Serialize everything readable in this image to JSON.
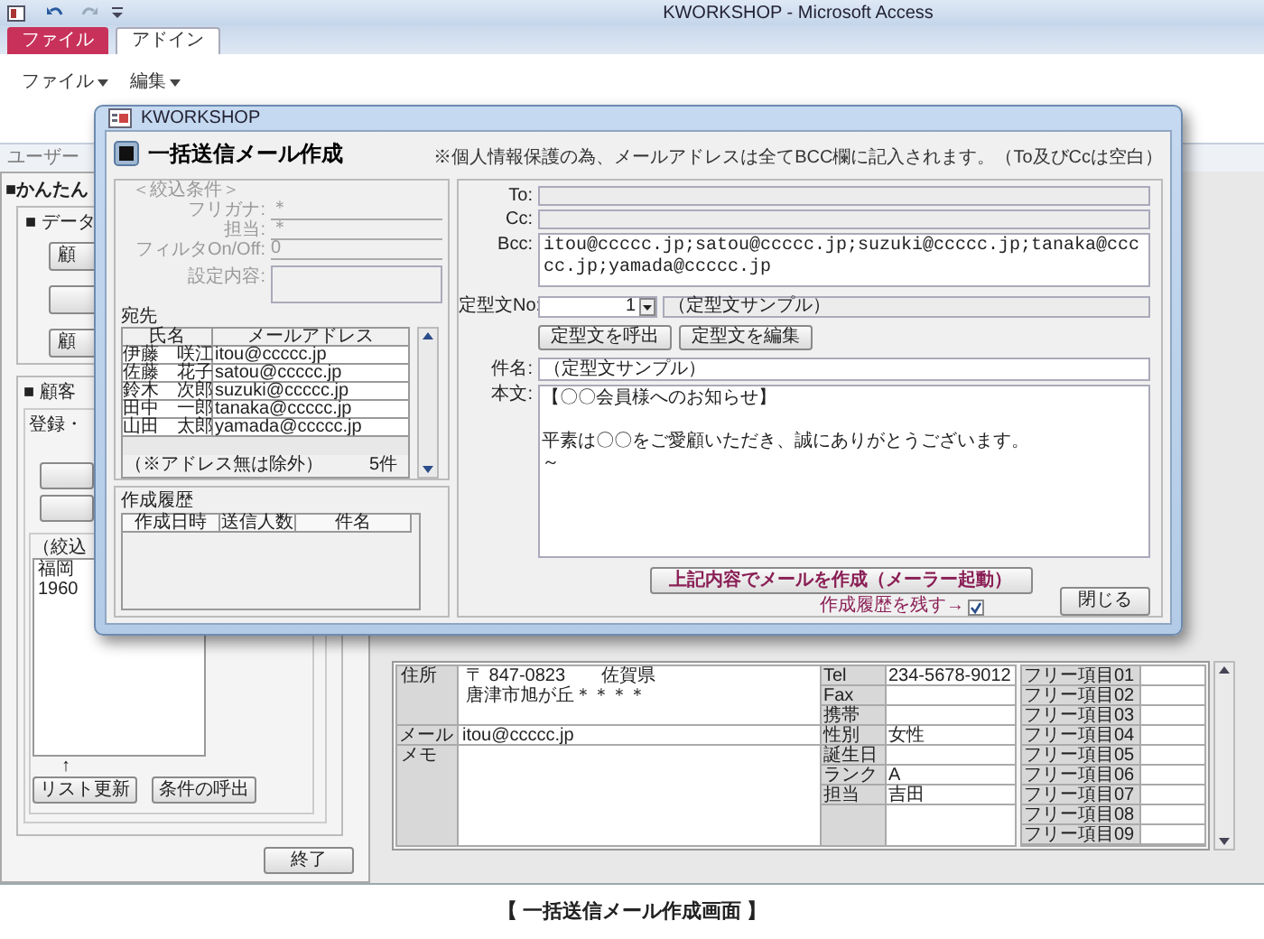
{
  "app": {
    "title": "KWORKSHOP - Microsoft Access",
    "ribbon_tabs": [
      {
        "label": "ファイル",
        "kind": "file",
        "selected": false
      },
      {
        "label": "アドイン",
        "kind": "tab",
        "selected": true
      }
    ],
    "ribbon_menus": [
      "ファイル",
      "編集"
    ],
    "nav_label": "ユーザー"
  },
  "background_form": {
    "heading": "■かんたん",
    "data_section": "■ データ",
    "data_buttons": [
      "顧",
      "顧"
    ],
    "customer_section": "■ 顧客",
    "register_label": "登録・",
    "filter_label": "（絞込",
    "filter_list": [
      "福岡",
      "1960"
    ],
    "arrow": "↑",
    "list_buttons": [
      "リスト更新",
      "条件の呼出"
    ],
    "exit": "終了"
  },
  "record": {
    "address_label": "住所",
    "address": [
      "〒 847-0823　　佐賀県",
      "唐津市旭が丘＊＊＊＊"
    ],
    "mail_label": "メール",
    "mail": "itou@ccccc.jp",
    "memo_label": "メモ",
    "contact": [
      {
        "label": "Tel",
        "value": "234-5678-9012"
      },
      {
        "label": "Fax"
      },
      {
        "label": "携帯"
      },
      {
        "label": "性別",
        "value": "女性"
      },
      {
        "label": "誕生日"
      },
      {
        "label": "ランク",
        "value": "A"
      },
      {
        "label": "担当",
        "value": "吉田"
      }
    ],
    "free_items": [
      "フリー項目01",
      "フリー項目02",
      "フリー項目03",
      "フリー項目04",
      "フリー項目05",
      "フリー項目06",
      "フリー項目07",
      "フリー項目08",
      "フリー項目09"
    ]
  },
  "dialog": {
    "title": "KWORKSHOP",
    "heading": "一括送信メール作成",
    "notice": "※個人情報保護の為、メールアドレスは全てBCC欄に記入されます。（To及びCcは空白）",
    "filter": {
      "title": "＜絞込条件＞",
      "fields": [
        {
          "label": "フリガナ:",
          "value": "＊"
        },
        {
          "label": "担当:",
          "value": "＊"
        },
        {
          "label": "フィルタOn/Off:",
          "value": "0"
        }
      ],
      "settings_label": "設定内容:"
    },
    "recipients": {
      "title": "宛先",
      "columns": [
        "氏名",
        "メールアドレス"
      ],
      "rows": [
        [
          "伊藤　咲江",
          "itou@ccccc.jp"
        ],
        [
          "佐藤　花子",
          "satou@ccccc.jp"
        ],
        [
          "鈴木　次郎",
          "suzuki@ccccc.jp"
        ],
        [
          "田中　一郎",
          "tanaka@ccccc.jp"
        ],
        [
          "山田　太郎",
          "yamada@ccccc.jp"
        ]
      ],
      "note": "（※アドレス無は除外）",
      "count": "5件"
    },
    "history": {
      "title": "作成履歴",
      "columns": [
        "作成日時",
        "送信人数",
        "件名"
      ]
    },
    "mail": {
      "to_label": "To:",
      "cc_label": "Cc:",
      "bcc_label": "Bcc:",
      "bcc": "itou@ccccc.jp;satou@ccccc.jp;suzuki@ccccc.jp;tanaka@ccccc.jp;yamada@ccccc.jp",
      "template_label": "定型文No:",
      "template_no": "1",
      "template_name": "（定型文サンプル）",
      "template_buttons": [
        "定型文を呼出",
        "定型文を編集"
      ],
      "subject_label": "件名:",
      "subject": "（定型文サンプル）",
      "body_label": "本文:",
      "body": [
        "【〇〇会員様へのお知らせ】",
        "平素は〇〇をご愛顧いただき、誠にありがとうございます。",
        "～"
      ],
      "create_button": "上記内容でメールを作成（メーラー起動）",
      "keep_history": {
        "label": "作成履歴を残す→",
        "checked": true
      },
      "close_button": "閉じる"
    }
  },
  "caption": "【 一括送信メール作成画面 】"
}
